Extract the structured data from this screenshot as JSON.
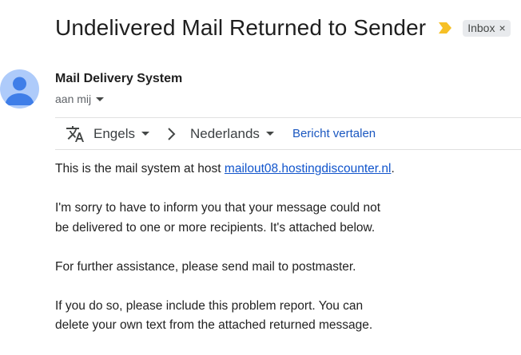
{
  "subject": "Undelivered Mail Returned to Sender",
  "label_chip": {
    "label": "Inbox",
    "close": "×"
  },
  "sender": {
    "name": "Mail Delivery System",
    "to_line": "aan mij"
  },
  "translation": {
    "from_language": "Engels",
    "to_language": "Nederlands",
    "translate_link": "Bericht vertalen"
  },
  "body": {
    "p1_prefix": "This is the mail system at host ",
    "p1_link": "mailout08.hostingdiscounter.nl",
    "p1_suffix": ".",
    "p2_line1": "I'm sorry to have to inform you that your message could not",
    "p2_line2": "be delivered to one or more recipients. It's attached below.",
    "p3": "For further assistance, please send mail to postmaster.",
    "p4_line1": "If you do so, please include this problem report. You can",
    "p4_line2": "delete your own text from the attached returned message."
  },
  "colors": {
    "importance_marker": "#f6c026",
    "avatar_bg": "#aecbfa",
    "avatar_fg": "#3f7ee8",
    "link": "#1155cc",
    "chip_bg": "#e8eaed"
  },
  "icons": [
    "importance-marker-icon",
    "close-icon",
    "person-icon",
    "chevron-down-icon",
    "translate-icon",
    "chevron-right-icon"
  ]
}
